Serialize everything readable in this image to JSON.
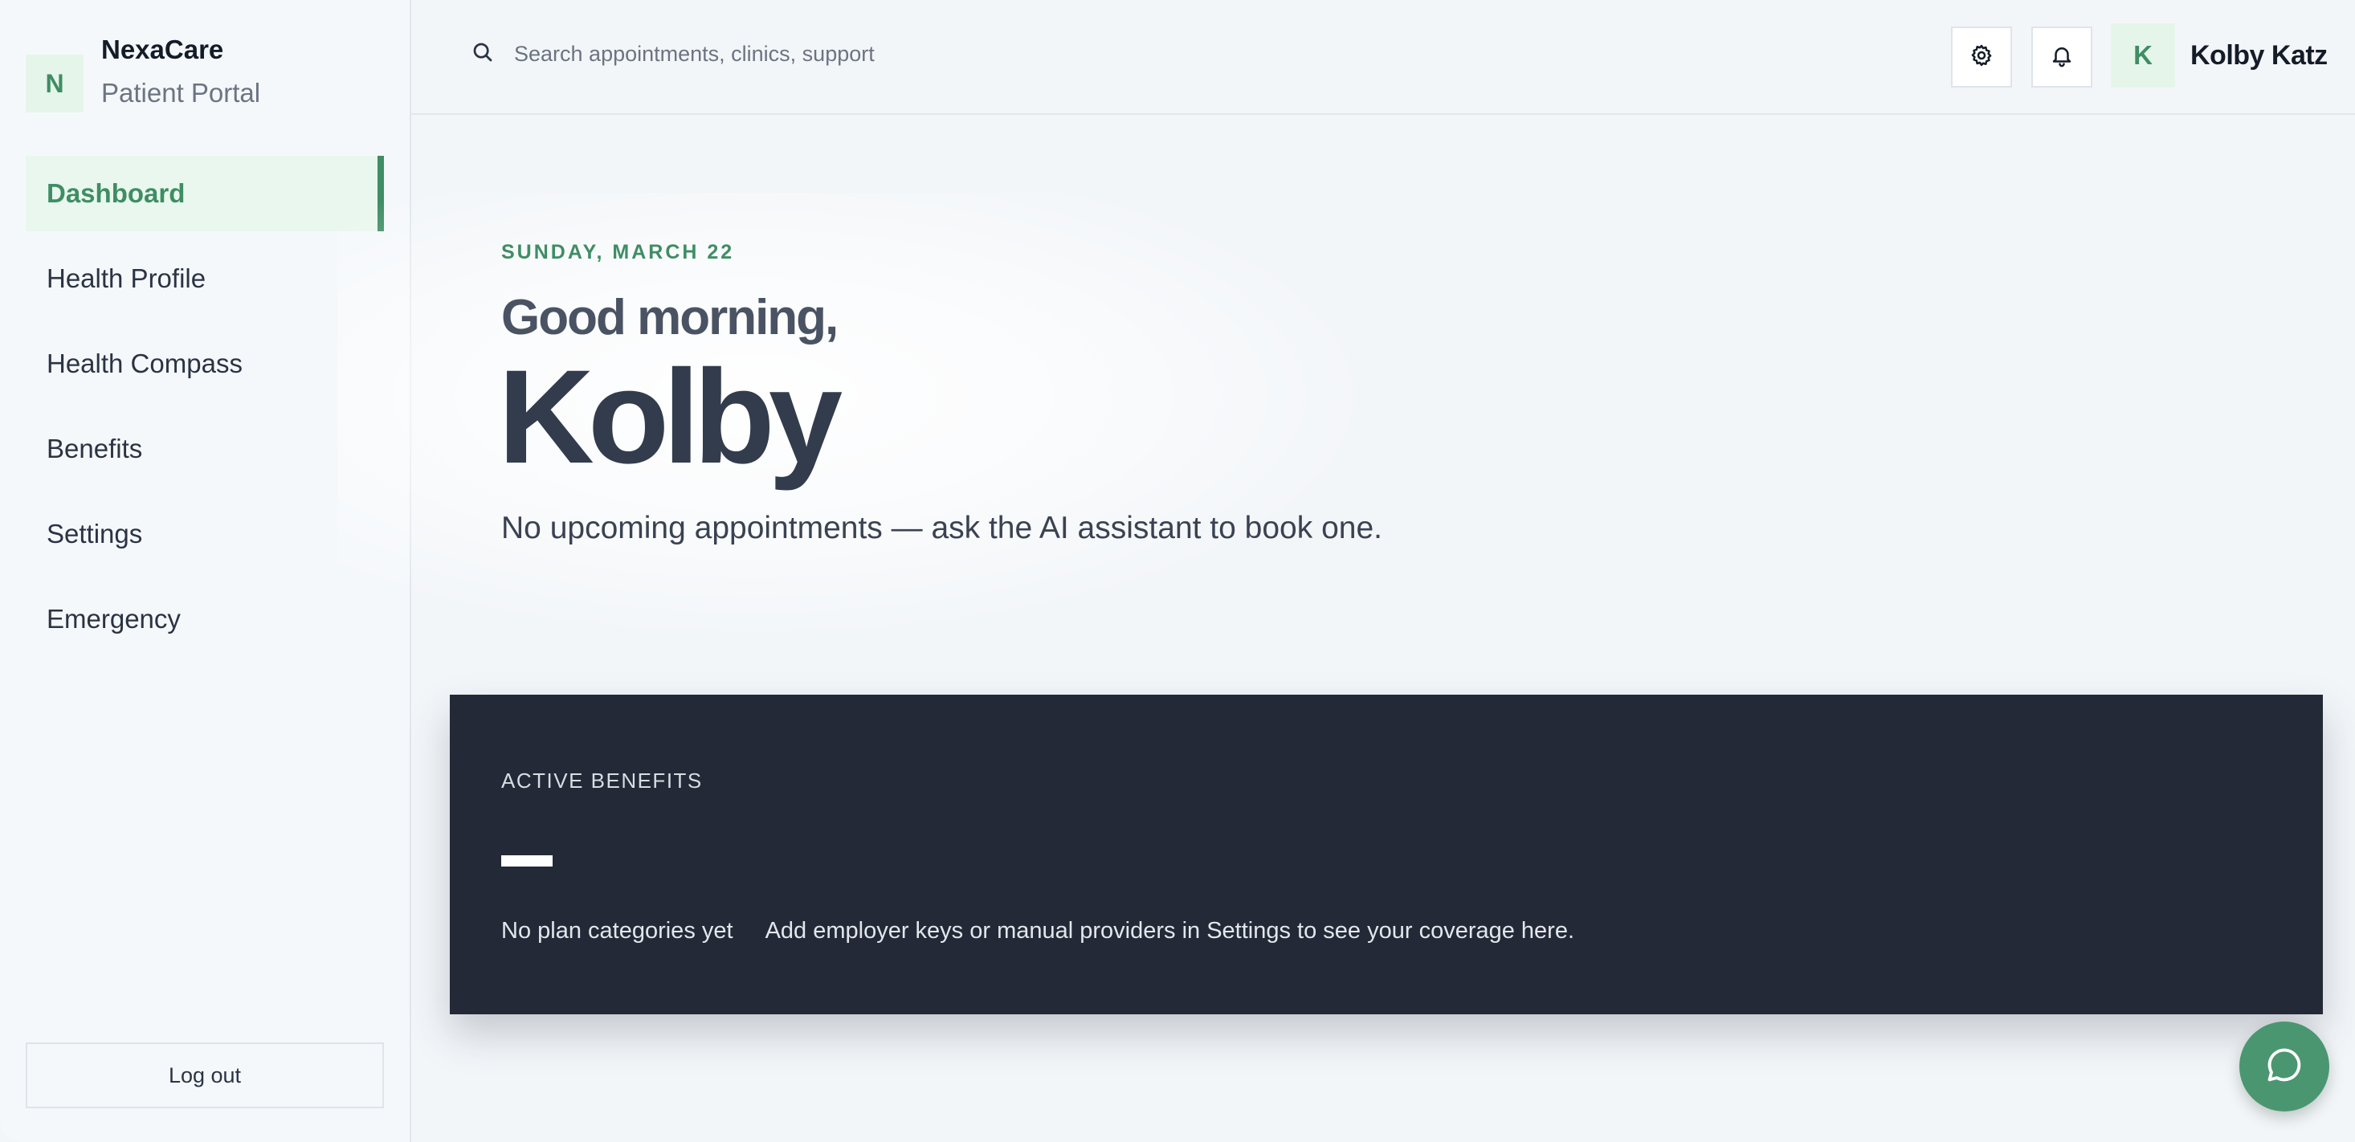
{
  "brand": {
    "logo_letter": "N",
    "name": "NexaCare",
    "subtitle": "Patient Portal"
  },
  "sidebar": {
    "items": [
      {
        "label": "Dashboard",
        "active": true
      },
      {
        "label": "Health Profile",
        "active": false
      },
      {
        "label": "Health Compass",
        "active": false
      },
      {
        "label": "Benefits",
        "active": false
      },
      {
        "label": "Settings",
        "active": false
      },
      {
        "label": "Emergency",
        "active": false
      }
    ],
    "logout_label": "Log out"
  },
  "header": {
    "search_placeholder": "Search appointments, clinics, support",
    "user_initial": "K",
    "user_name": "Kolby Katz"
  },
  "hero": {
    "date": "SUNDAY, MARCH 22",
    "greeting": "Good morning,",
    "first_name": "Kolby",
    "message": "No upcoming appointments — ask the AI assistant to book one."
  },
  "benefits": {
    "title": "ACTIVE BENEFITS",
    "empty_label": "No plan categories yet",
    "empty_description": "Add employer keys or manual providers in Settings to see your coverage here."
  },
  "colors": {
    "accent": "#3f8d64",
    "card_bg": "#232936",
    "page_bg": "#f3f6f9"
  }
}
